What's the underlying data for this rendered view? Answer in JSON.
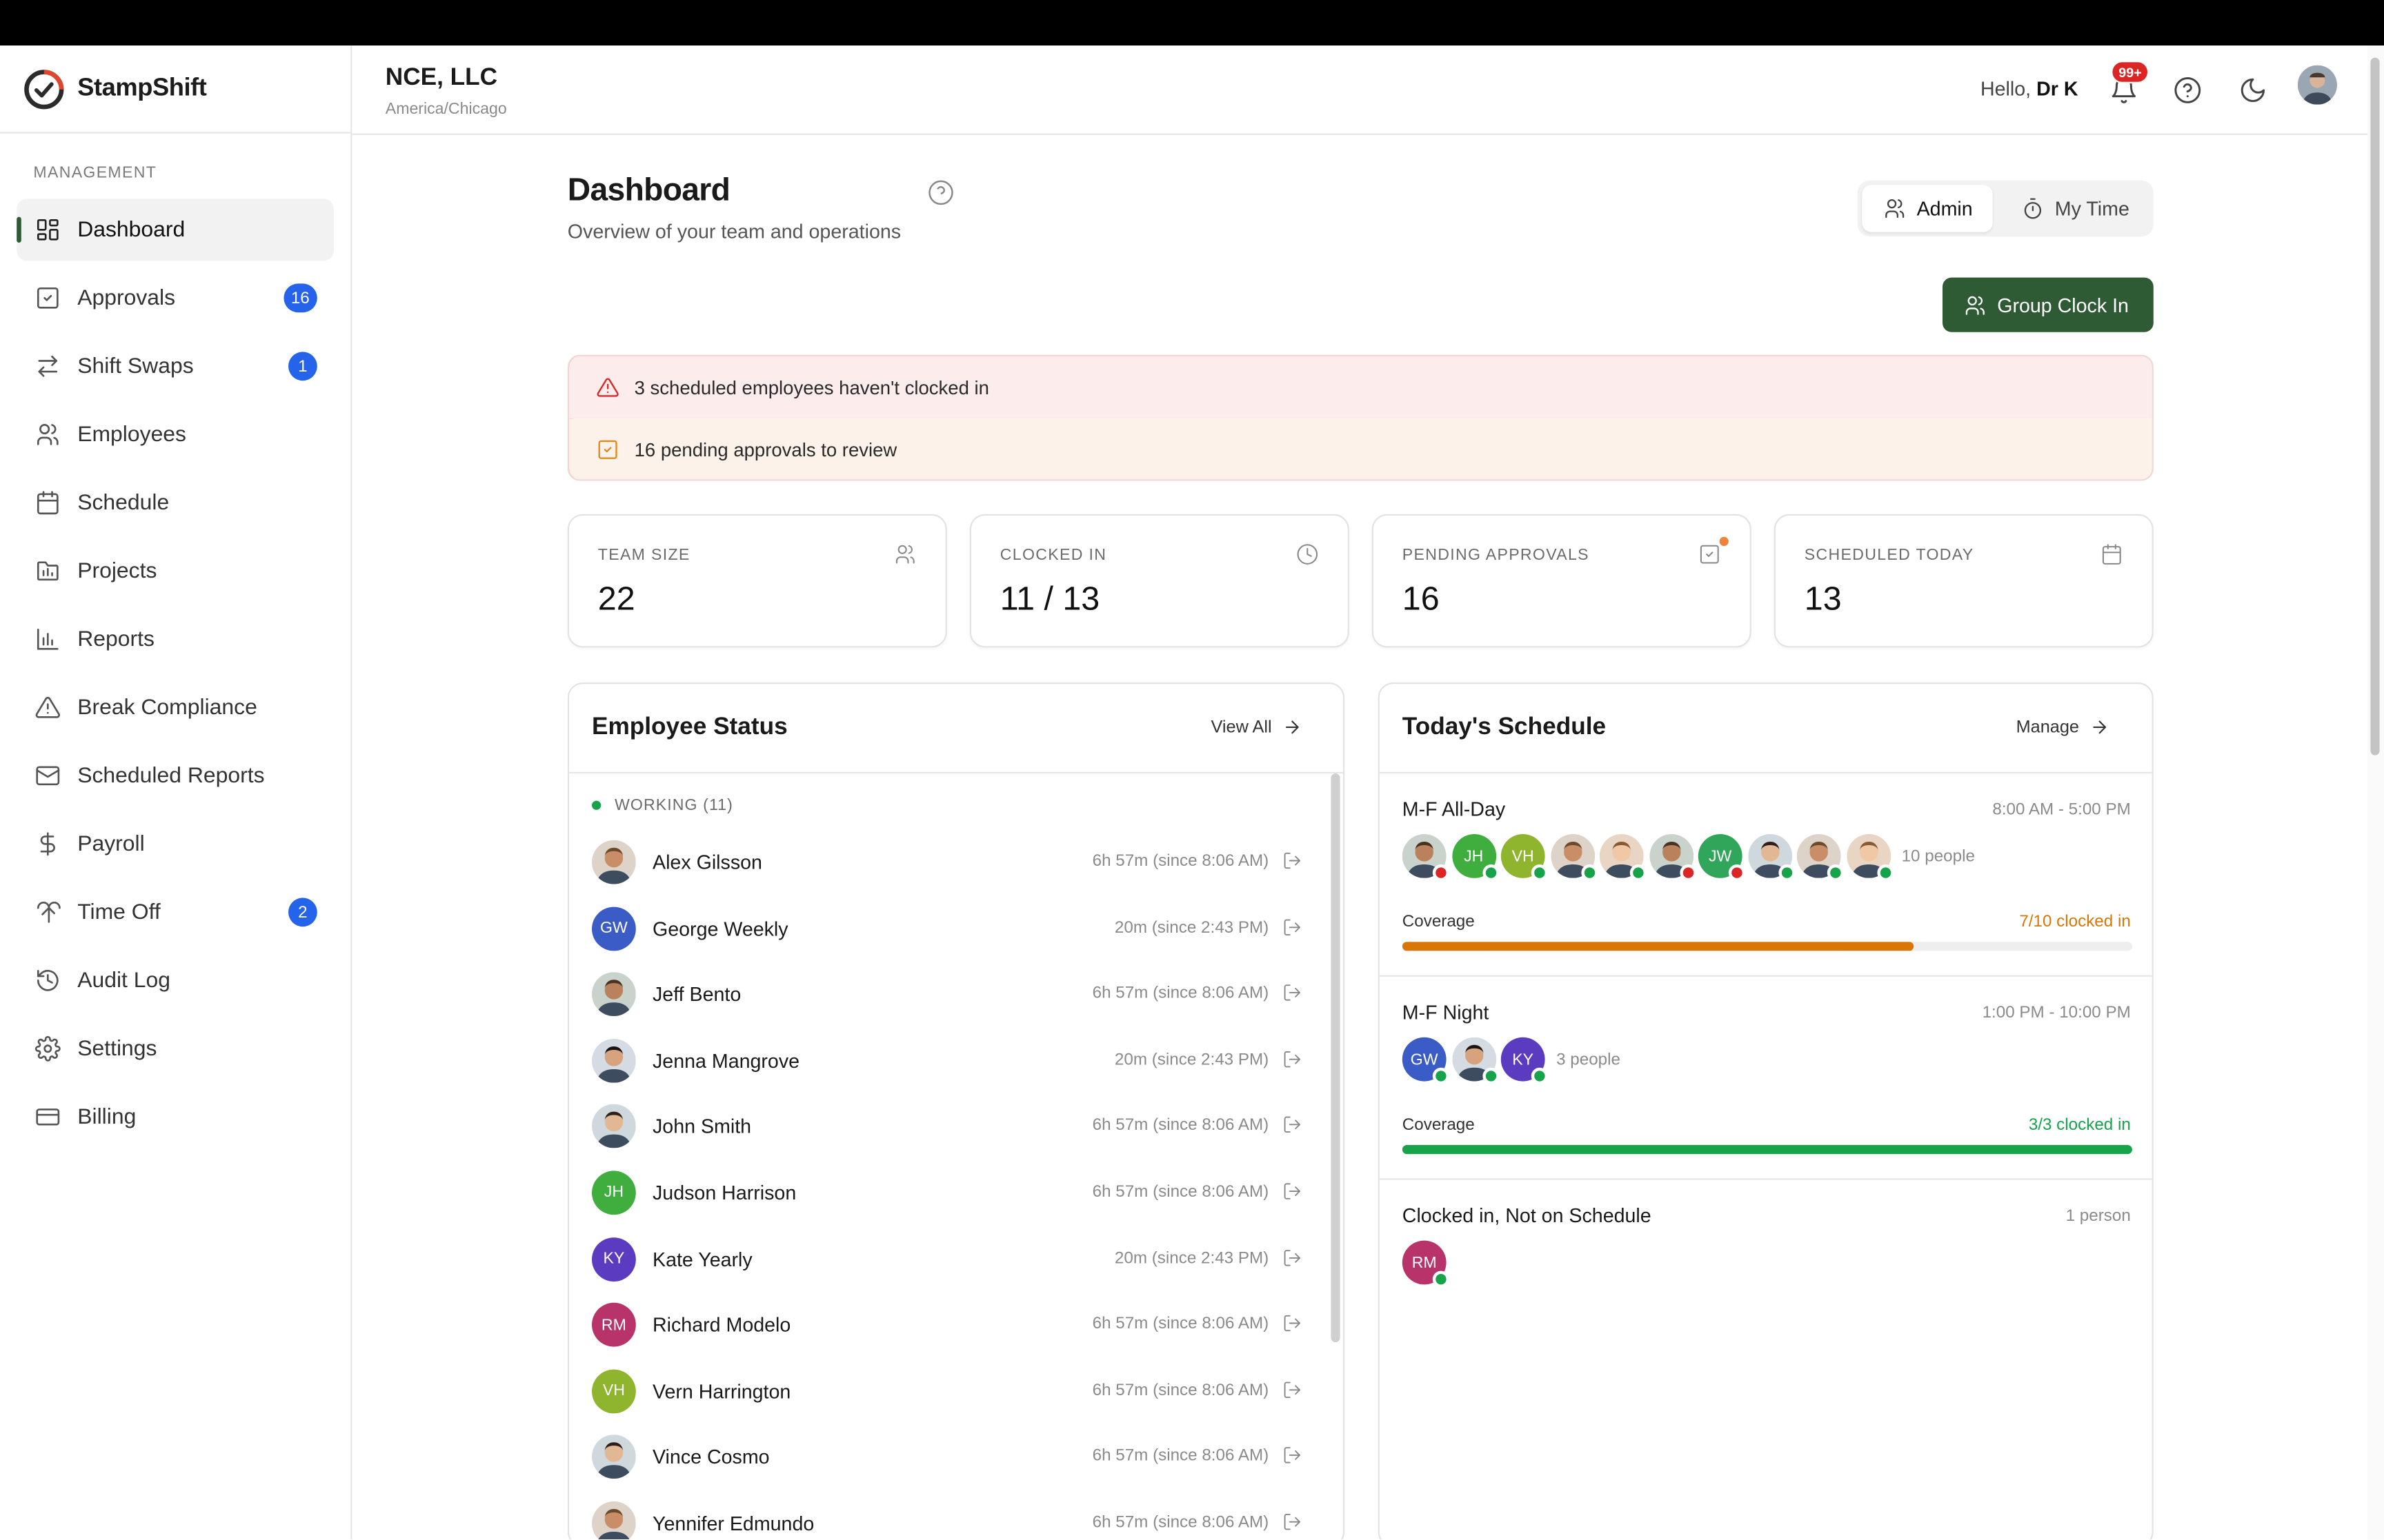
{
  "brand": {
    "name": "StampShift"
  },
  "sidebar": {
    "section": "MANAGEMENT",
    "items": [
      {
        "label": "Dashboard",
        "icon": "dashboard-icon",
        "active": true
      },
      {
        "label": "Approvals",
        "icon": "approvals-icon",
        "badge": "16"
      },
      {
        "label": "Shift Swaps",
        "icon": "swap-icon",
        "badge": "1"
      },
      {
        "label": "Employees",
        "icon": "employees-icon"
      },
      {
        "label": "Schedule",
        "icon": "calendar-icon"
      },
      {
        "label": "Projects",
        "icon": "projects-icon"
      },
      {
        "label": "Reports",
        "icon": "reports-icon"
      },
      {
        "label": "Break Compliance",
        "icon": "warning-icon"
      },
      {
        "label": "Scheduled Reports",
        "icon": "mail-icon"
      },
      {
        "label": "Payroll",
        "icon": "dollar-icon"
      },
      {
        "label": "Time Off",
        "icon": "palm-tree-icon",
        "badge": "2"
      },
      {
        "label": "Audit Log",
        "icon": "history-icon"
      },
      {
        "label": "Settings",
        "icon": "gear-icon"
      },
      {
        "label": "Billing",
        "icon": "credit-card-icon"
      }
    ]
  },
  "header": {
    "org_name": "NCE, LLC",
    "timezone": "America/Chicago",
    "hello_prefix": "Hello,",
    "user_name": "Dr K",
    "notification_badge": "99+"
  },
  "main": {
    "title": "Dashboard",
    "subtitle": "Overview of your team and operations",
    "toggle": {
      "admin_label": "Admin",
      "mytime_label": "My Time"
    },
    "group_clock_in": "Group Clock In",
    "alerts": [
      {
        "text": "3 scheduled employees haven't clocked in",
        "icon": "alert-triangle-icon"
      },
      {
        "text": "16 pending approvals to review",
        "icon": "check-square-icon"
      }
    ],
    "stats": [
      {
        "label": "TEAM SIZE",
        "value": "22",
        "icon": "users-icon"
      },
      {
        "label": "CLOCKED IN",
        "value": "11 / 13",
        "icon": "clock-icon"
      },
      {
        "label": "PENDING APPROVALS",
        "value": "16",
        "icon": "check-square-icon"
      },
      {
        "label": "SCHEDULED TODAY",
        "value": "13",
        "icon": "calendar-icon"
      }
    ]
  },
  "employee_status": {
    "title": "Employee Status",
    "view_all": "View All",
    "group_label": "WORKING (11)",
    "employees": [
      {
        "name": "Alex Gilsson",
        "time": "6h 57m (since 8:06 AM)",
        "initials": "",
        "photo": true
      },
      {
        "name": "George Weekly",
        "time": "20m (since 2:43 PM)",
        "initials": "GW",
        "color": "#3b5bc6"
      },
      {
        "name": "Jeff Bento",
        "time": "6h 57m (since 8:06 AM)",
        "initials": "",
        "photo": true
      },
      {
        "name": "Jenna Mangrove",
        "time": "20m (since 2:43 PM)",
        "initials": "",
        "photo": true
      },
      {
        "name": "John Smith",
        "time": "6h 57m (since 8:06 AM)",
        "initials": "",
        "photo": true
      },
      {
        "name": "Judson Harrison",
        "time": "6h 57m (since 8:06 AM)",
        "initials": "JH",
        "color": "#3fae3f"
      },
      {
        "name": "Kate Yearly",
        "time": "20m (since 2:43 PM)",
        "initials": "KY",
        "color": "#5b3bbf"
      },
      {
        "name": "Richard Modelo",
        "time": "6h 57m (since 8:06 AM)",
        "initials": "RM",
        "color": "#b8336a"
      },
      {
        "name": "Vern Harrington",
        "time": "6h 57m (since 8:06 AM)",
        "initials": "VH",
        "color": "#8fb52f"
      },
      {
        "name": "Vince Cosmo",
        "time": "6h 57m (since 8:06 AM)",
        "initials": "",
        "photo": true
      },
      {
        "name": "Yennifer Edmundo",
        "time": "6h 57m (since 8:06 AM)",
        "initials": "",
        "photo": true
      }
    ]
  },
  "schedule": {
    "title": "Today's Schedule",
    "manage": "Manage",
    "shifts": [
      {
        "name": "M-F All-Day",
        "hours": "8:00 AM - 5:00 PM",
        "people_label": "10 people",
        "coverage_label": "Coverage",
        "coverage_text": "7/10 clocked in",
        "coverage_fraction": 0.7,
        "coverage_color": "#d97706",
        "members": [
          {
            "initials": "",
            "status": "#dc2626"
          },
          {
            "initials": "JH",
            "color": "#3fae3f",
            "status": "#16a34a"
          },
          {
            "initials": "VH",
            "color": "#8fb52f",
            "status": "#16a34a"
          },
          {
            "initials": "",
            "status": "#16a34a"
          },
          {
            "initials": "",
            "status": "#16a34a"
          },
          {
            "initials": "",
            "status": "#dc2626"
          },
          {
            "initials": "JW",
            "color": "#2fa65a",
            "status": "#dc2626"
          },
          {
            "initials": "",
            "status": "#16a34a"
          },
          {
            "initials": "",
            "status": "#16a34a"
          },
          {
            "initials": "",
            "status": "#16a34a"
          }
        ]
      },
      {
        "name": "M-F Night",
        "hours": "1:00 PM - 10:00 PM",
        "people_label": "3 people",
        "coverage_label": "Coverage",
        "coverage_text": "3/3 clocked in",
        "coverage_fraction": 1.0,
        "coverage_color": "#16a34a",
        "members": [
          {
            "initials": "GW",
            "color": "#3b5bc6",
            "status": "#16a34a"
          },
          {
            "initials": "",
            "status": "#16a34a"
          },
          {
            "initials": "KY",
            "color": "#5b3bbf",
            "status": "#16a34a"
          }
        ]
      }
    ],
    "unscheduled": {
      "title": "Clocked in, Not on Schedule",
      "count_label": "1 person",
      "members": [
        {
          "initials": "RM",
          "color": "#b8336a",
          "status": "#16a34a"
        }
      ]
    }
  }
}
